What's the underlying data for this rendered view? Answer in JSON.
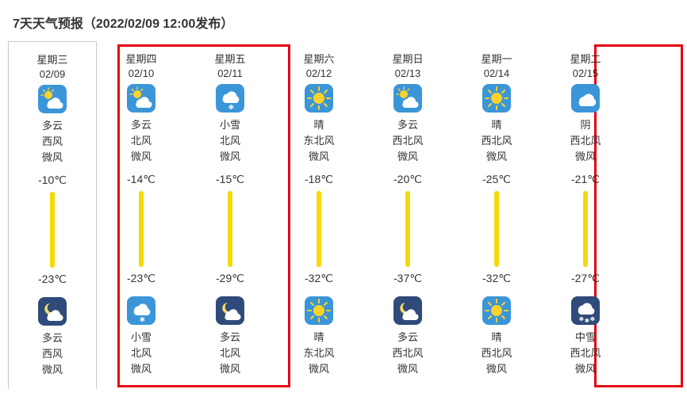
{
  "header": "7天天气预报（2022/02/09 12:00发布）",
  "days": [
    {
      "weekday": "星期三",
      "date": "02/09",
      "day_icon": "partly-cloudy",
      "day_cond": "多云",
      "day_wind": "西风",
      "day_wscale": "微风",
      "hi": "-10℃",
      "lo": "-23℃",
      "night_icon": "night-partly-cloudy",
      "night_cond": "多云",
      "night_wind": "西风",
      "night_wscale": "微风",
      "selected": true
    },
    {
      "weekday": "星期四",
      "date": "02/10",
      "day_icon": "partly-cloudy",
      "day_cond": "多云",
      "day_wind": "北风",
      "day_wscale": "微风",
      "hi": "-14℃",
      "lo": "-23℃",
      "night_icon": "light-snow",
      "night_cond": "小雪",
      "night_wind": "北风",
      "night_wscale": "微风"
    },
    {
      "weekday": "星期五",
      "date": "02/11",
      "day_icon": "light-snow",
      "day_cond": "小雪",
      "day_wind": "北风",
      "day_wscale": "微风",
      "hi": "-15℃",
      "lo": "-29℃",
      "night_icon": "night-partly-cloudy",
      "night_cond": "多云",
      "night_wind": "北风",
      "night_wscale": "微风"
    },
    {
      "weekday": "星期六",
      "date": "02/12",
      "day_icon": "sunny",
      "day_cond": "晴",
      "day_wind": "东北风",
      "day_wscale": "微风",
      "hi": "-18℃",
      "lo": "-32℃",
      "night_icon": "sunny",
      "night_cond": "晴",
      "night_wind": "东北风",
      "night_wscale": "微风"
    },
    {
      "weekday": "星期日",
      "date": "02/13",
      "day_icon": "partly-cloudy",
      "day_cond": "多云",
      "day_wind": "西北风",
      "day_wscale": "微风",
      "hi": "-20℃",
      "lo": "-37℃",
      "night_icon": "night-partly-cloudy",
      "night_cond": "多云",
      "night_wind": "西北风",
      "night_wscale": "微风"
    },
    {
      "weekday": "星期一",
      "date": "02/14",
      "day_icon": "sunny",
      "day_cond": "晴",
      "day_wind": "西北风",
      "day_wscale": "微风",
      "hi": "-25℃",
      "lo": "-32℃",
      "night_icon": "sunny",
      "night_cond": "晴",
      "night_wind": "西北风",
      "night_wscale": "微风"
    },
    {
      "weekday": "星期二",
      "date": "02/15",
      "day_icon": "overcast",
      "day_cond": "阴",
      "day_wind": "西北风",
      "day_wscale": "微风",
      "hi": "-21℃",
      "lo": "-27℃",
      "night_icon": "moderate-snow",
      "night_cond": "中雪",
      "night_wind": "西北风",
      "night_wscale": "微风"
    }
  ]
}
